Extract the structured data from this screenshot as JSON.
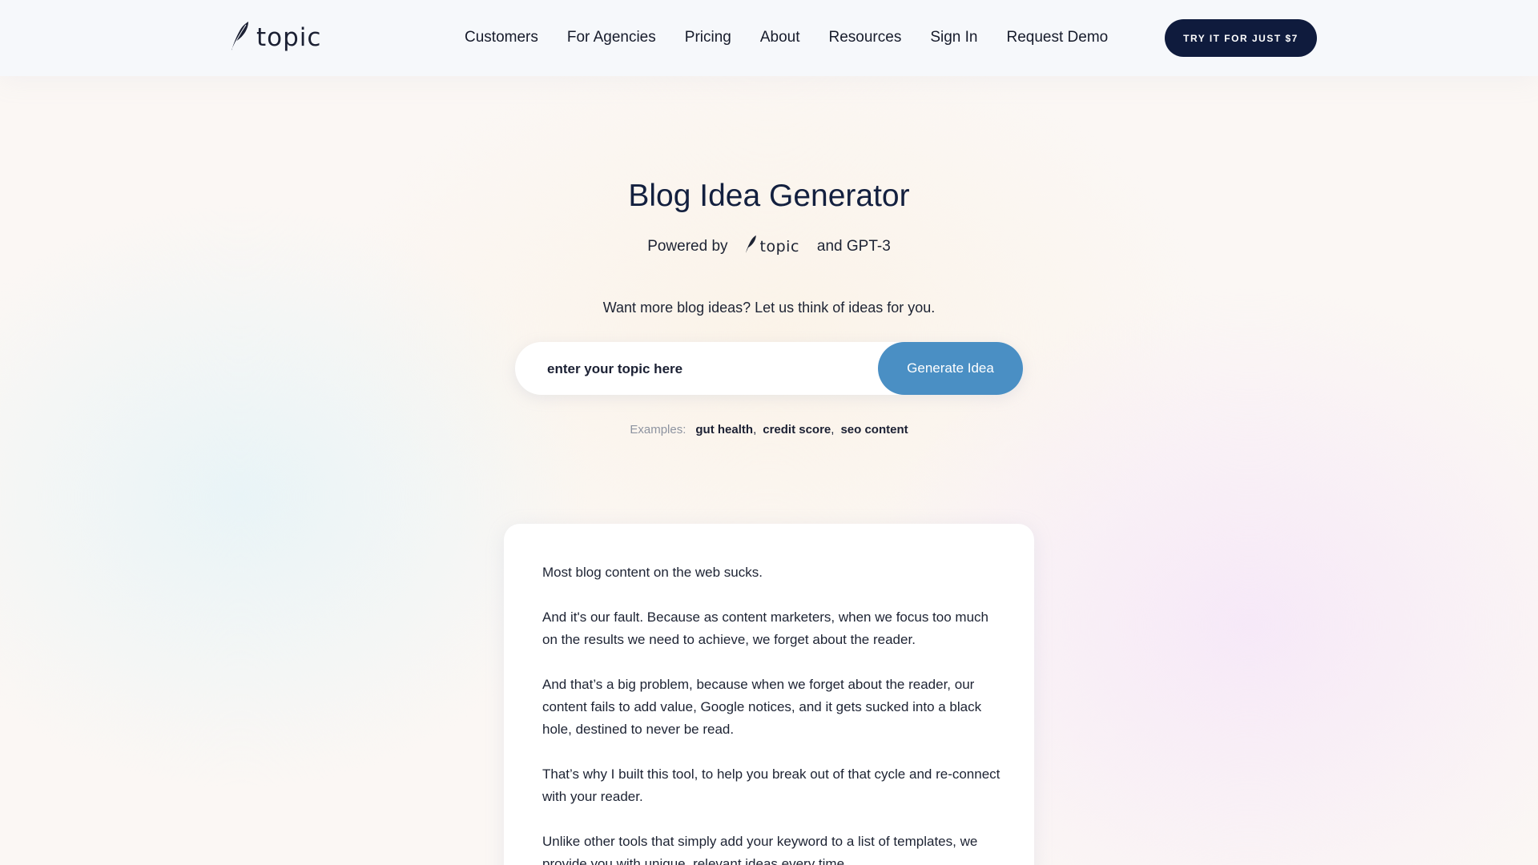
{
  "header": {
    "logo_text": "topic",
    "nav": [
      {
        "label": "Customers"
      },
      {
        "label": "For Agencies"
      },
      {
        "label": "Pricing"
      },
      {
        "label": "About"
      },
      {
        "label": "Resources"
      },
      {
        "label": "Sign In"
      },
      {
        "label": "Request Demo"
      }
    ],
    "cta_label": "TRY IT FOR JUST $7"
  },
  "hero": {
    "title": "Blog Idea Generator",
    "powered_prefix": "Powered by",
    "powered_logo_text": "topic",
    "powered_suffix": "and GPT-3",
    "tagline": "Want more blog ideas? Let us think of ideas for you."
  },
  "search": {
    "placeholder": "enter your topic here",
    "button_label": "Generate Idea"
  },
  "examples": {
    "label": "Examples:",
    "items": [
      {
        "label": "gut health"
      },
      {
        "label": "credit score"
      },
      {
        "label": "seo content"
      }
    ],
    "separator": ","
  },
  "card": {
    "paragraphs": [
      "Most blog content on the web sucks.",
      "And it's our fault. Because as content marketers, when we focus too much on the results we need to achieve, we forget about the reader.",
      "And that’s a big problem, because when we forget about the reader, our content fails to add value, Google notices, and it gets sucked into a black hole, destined to never be read.",
      "That’s why I built this tool, to help you break out of that cycle and re-connect with your reader.",
      "Unlike other tools that simply add your keyword to a list of templates, we provide you with unique, relevant ideas every time."
    ]
  },
  "colors": {
    "navy": "#0f1b3d",
    "button_blue": "#4a8fc4",
    "text": "#13203f"
  },
  "icons": {
    "logo": "feather-quill-icon"
  }
}
